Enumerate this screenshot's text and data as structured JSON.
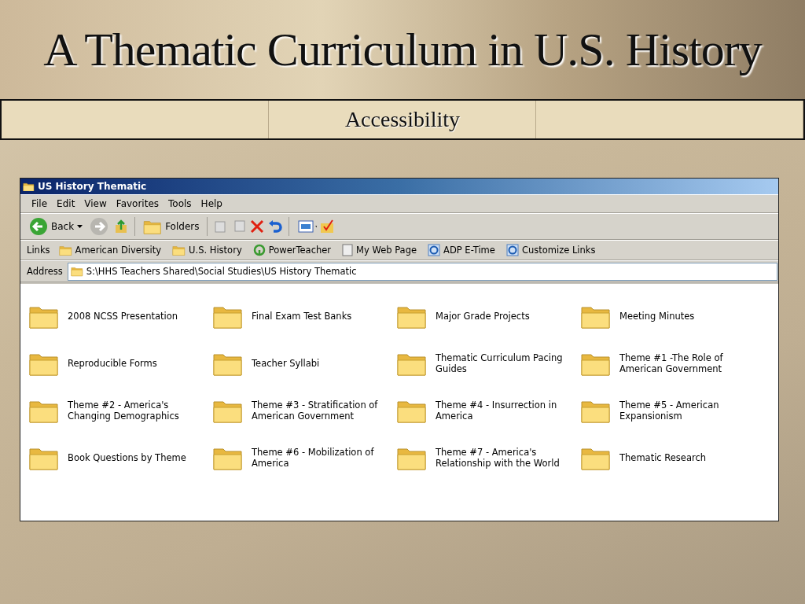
{
  "slide": {
    "title": "A Thematic Curriculum in U.S. History",
    "subtitle": "Accessibility"
  },
  "window": {
    "title": "US History Thematic",
    "menu": [
      "File",
      "Edit",
      "View",
      "Favorites",
      "Tools",
      "Help"
    ],
    "toolbar": {
      "back": "Back",
      "folders": "Folders"
    },
    "links_label": "Links",
    "links": [
      {
        "label": "American Diversity",
        "kind": "folder"
      },
      {
        "label": "U.S. History",
        "kind": "folder"
      },
      {
        "label": "PowerTeacher",
        "kind": "power"
      },
      {
        "label": "My Web Page",
        "kind": "page"
      },
      {
        "label": "ADP E-Time",
        "kind": "ie"
      },
      {
        "label": "Customize Links",
        "kind": "ie"
      }
    ],
    "address_label": "Address",
    "address": "S:\\HHS Teachers Shared\\Social Studies\\US History Thematic",
    "folders": [
      "2008 NCSS Presentation",
      "Final Exam Test Banks",
      "Major Grade Projects",
      "Meeting Minutes",
      "Reproducible Forms",
      "Teacher Syllabi",
      "Thematic Curriculum Pacing Guides",
      "Theme #1 -The Role of American Government",
      "Theme #2 - America's Changing Demographics",
      "Theme #3 - Stratification of American Government",
      "Theme #4 - Insurrection in America",
      "Theme #5 - American Expansionism",
      "Book Questions by Theme",
      "Theme #6 - Mobilization of America",
      "Theme #7 - America's Relationship with the World",
      "Thematic Research"
    ]
  }
}
